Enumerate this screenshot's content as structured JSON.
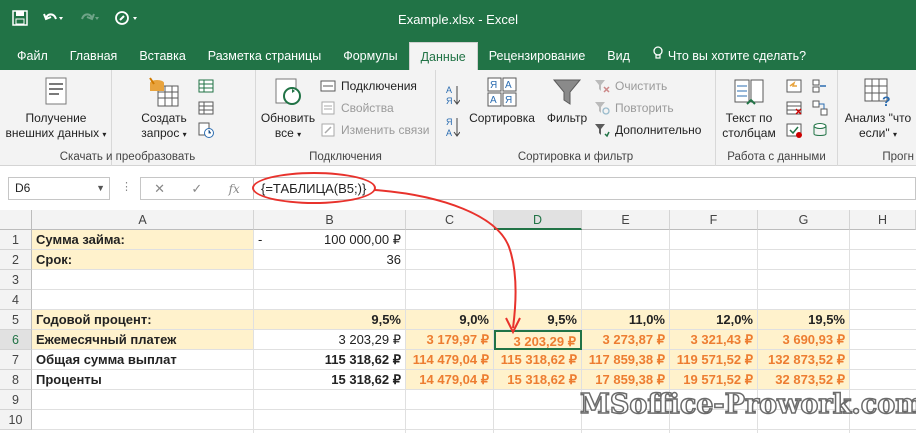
{
  "window": {
    "title": "Example.xlsx - Excel"
  },
  "tabs": [
    {
      "label": "Файл",
      "active": false
    },
    {
      "label": "Главная",
      "active": false
    },
    {
      "label": "Вставка",
      "active": false
    },
    {
      "label": "Разметка страницы",
      "active": false
    },
    {
      "label": "Формулы",
      "active": false
    },
    {
      "label": "Данные",
      "active": true
    },
    {
      "label": "Рецензирование",
      "active": false
    },
    {
      "label": "Вид",
      "active": false
    }
  ],
  "tell_me": "Что вы хотите сделать?",
  "ribbon": {
    "get_external": {
      "line1": "Получение",
      "line2": "внешних данных"
    },
    "new_query": {
      "line1": "Создать",
      "line2": "запрос"
    },
    "group1_label": "Скачать и преобразовать",
    "refresh_all": {
      "line1": "Обновить",
      "line2": "все"
    },
    "connections": "Подключения",
    "properties": "Свойства",
    "edit_links": "Изменить связи",
    "group2_label": "Подключения",
    "sort": "Сортировка",
    "filter": "Фильтр",
    "clear": "Очистить",
    "reapply": "Повторить",
    "advanced": "Дополнительно",
    "group3_label": "Сортировка и фильтр",
    "text_to_columns": {
      "line1": "Текст по",
      "line2": "столбцам"
    },
    "group4_label": "Работа с данными",
    "whatif": {
      "line1": "Анализ \"что",
      "line2": "если\""
    },
    "group5_label": "Прогн"
  },
  "formula_bar": {
    "name_box": "D6",
    "formula": "{=ТАБЛИЦА(B5;)}"
  },
  "columns": [
    "A",
    "B",
    "C",
    "D",
    "E",
    "F",
    "G",
    "H"
  ],
  "rows": [
    "1",
    "2",
    "3",
    "4",
    "5",
    "6",
    "7",
    "8",
    "9",
    "10"
  ],
  "cells": {
    "a1": "Сумма займа:",
    "b1_minus": "-",
    "b1": "100 000,00 ₽",
    "a2": "Срок:",
    "b2": "36",
    "a5": "Годовой процент:",
    "b5": "9,5%",
    "c5": "9,0%",
    "d5": "9,5%",
    "e5": "11,0%",
    "f5": "12,0%",
    "g5": "19,5%",
    "a6": "Ежемесячный платеж",
    "b6": "3 203,29 ₽",
    "c6": "3 179,97 ₽",
    "d6": "3 203,29 ₽",
    "e6": "3 273,87 ₽",
    "f6": "3 321,43 ₽",
    "g6": "3 690,93 ₽",
    "a7": "Общая сумма выплат",
    "b7": "115 318,62 ₽",
    "c7": "114 479,04 ₽",
    "d7": "115 318,62 ₽",
    "e7": "117 859,38 ₽",
    "f7": "119 571,52 ₽",
    "g7": "132 873,52 ₽",
    "a8": "Проценты",
    "b8": "15 318,62 ₽",
    "c8": "14 479,04 ₽",
    "d8": "15 318,62 ₽",
    "e8": "17 859,38 ₽",
    "f8": "19 571,52 ₽",
    "g8": "32 873,52 ₽"
  },
  "watermark": "MSoffice-Prowork.com",
  "colors": {
    "excel_green": "#217346",
    "highlight_yellow": "#fff2cc",
    "result_orange": "#ed7d31",
    "annotation_red": "#e8322c"
  }
}
